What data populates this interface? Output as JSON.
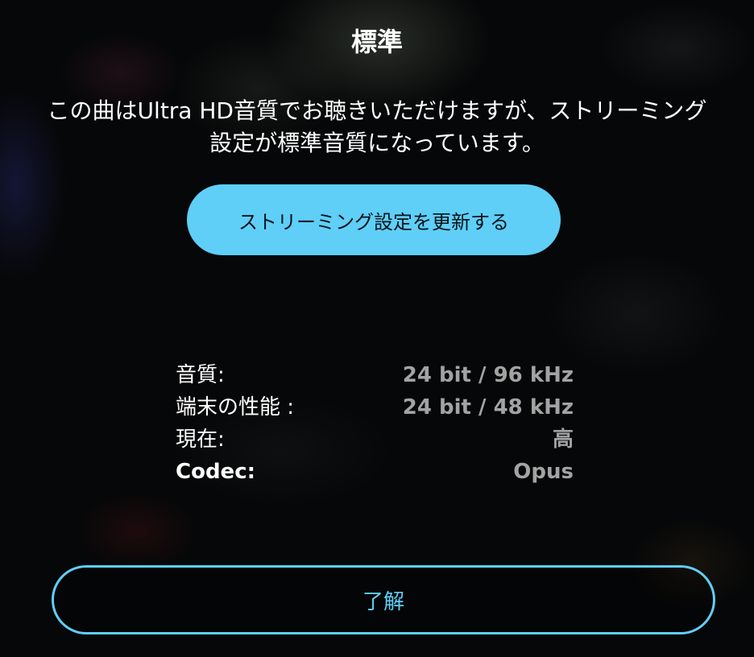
{
  "dialog": {
    "title": "標準",
    "message": "この曲はUltra HD音質でお聴きいただけますが、ストリーミング設定が標準音質になっています。",
    "update_button_label": "ストリーミング設定を更新する",
    "details": [
      {
        "label": "音質:",
        "value": "24 bit / 96 kHz"
      },
      {
        "label": "端末の性能 :",
        "value": "24 bit / 48 kHz"
      },
      {
        "label": "現在:",
        "value": "高"
      },
      {
        "label": "Codec:",
        "value": "Opus"
      }
    ],
    "ok_button_label": "了解"
  },
  "colors": {
    "accent": "#5fcff8",
    "background": "#060708",
    "text_primary": "#ffffff",
    "text_secondary": "#a3a3a3"
  }
}
